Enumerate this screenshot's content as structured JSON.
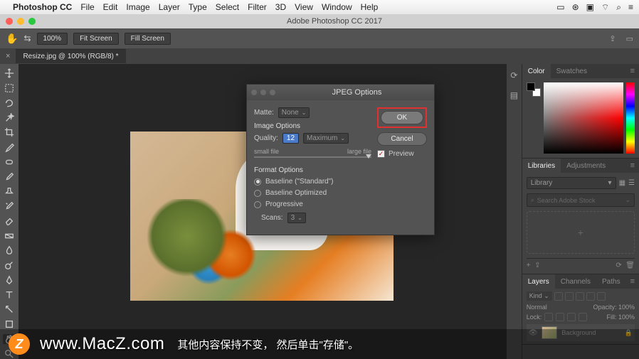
{
  "menubar": {
    "apple": "",
    "app": "Photoshop CC",
    "items": [
      "File",
      "Edit",
      "Image",
      "Layer",
      "Type",
      "Select",
      "Filter",
      "3D",
      "View",
      "Window",
      "Help"
    ],
    "right_icons": [
      "display-icon",
      "cc-icon",
      "shield-icon",
      "wifi-icon",
      "search-icon",
      "menu-icon"
    ]
  },
  "titlebar": {
    "title": "Adobe Photoshop CC 2017"
  },
  "optbar": {
    "zoom": "100%",
    "fit": "Fit Screen",
    "fill": "Fill Screen"
  },
  "document_tab": "Resize.jpg @ 100% (RGB/8) *",
  "dialog": {
    "title": "JPEG Options",
    "matte_label": "Matte:",
    "matte_value": "None",
    "image_options": "Image Options",
    "quality_label": "Quality:",
    "quality_value": "12",
    "quality_preset": "Maximum",
    "small_file": "small file",
    "large_file": "large file",
    "format_options": "Format Options",
    "baseline_std": "Baseline (\"Standard\")",
    "baseline_opt": "Baseline Optimized",
    "progressive": "Progressive",
    "scans_label": "Scans:",
    "scans_value": "3",
    "ok": "OK",
    "cancel": "Cancel",
    "preview": "Preview"
  },
  "panels": {
    "color": {
      "tab1": "Color",
      "tab2": "Swatches"
    },
    "libraries": {
      "tab1": "Libraries",
      "tab2": "Adjustments",
      "selector": "Library",
      "search_ph": "Search Adobe Stock"
    },
    "layers": {
      "tab1": "Layers",
      "tab2": "Channels",
      "tab3": "Paths",
      "kind": "Kind",
      "blend": "Normal",
      "opacity_l": "Opacity:",
      "opacity_v": "100%",
      "lock_l": "Lock:",
      "fill_l": "Fill:",
      "fill_v": "100%",
      "bg_layer": "Background"
    }
  },
  "overlay": {
    "badge": "Z",
    "url": "www.MacZ.com",
    "subtitle": "其他内容保持不变，  然后单击\"存储\"。"
  }
}
